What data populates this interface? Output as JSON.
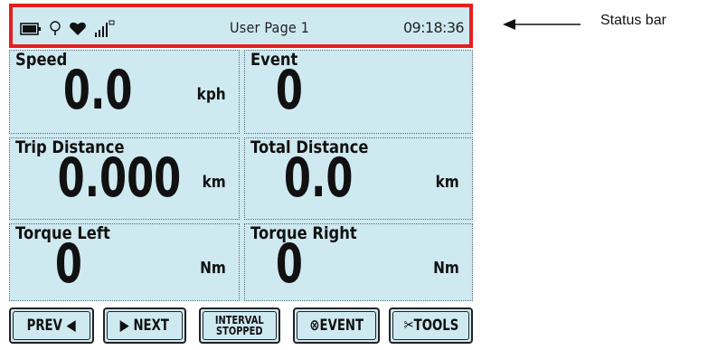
{
  "status_bar": {
    "icons": [
      "battery-icon",
      "bulb-icon",
      "heart-icon",
      "signal-icon"
    ],
    "title": "User Page 1",
    "clock": "09:18:36",
    "border_color": "#e51e1e",
    "background": "#cfe9f1"
  },
  "fields": [
    {
      "label": "Speed",
      "value": "0.0",
      "unit": "kph"
    },
    {
      "label": "Event",
      "value": "0",
      "unit": ""
    },
    {
      "label": "Trip Distance",
      "value": "0.000",
      "unit": "km"
    },
    {
      "label": "Total Distance",
      "value": "0.0",
      "unit": "km"
    },
    {
      "label": "Torque Left",
      "value": "0",
      "unit": "Nm"
    },
    {
      "label": "Torque Right",
      "value": "0",
      "unit": "Nm"
    }
  ],
  "buttons": {
    "prev": "PREV ◀",
    "next": "▶ NEXT",
    "interval_line1": "INTERVAL",
    "interval_line2": "STOPPED",
    "event": "⊗EVENT",
    "tools": "✂TOOLS"
  },
  "callout": {
    "label": "Status bar"
  }
}
